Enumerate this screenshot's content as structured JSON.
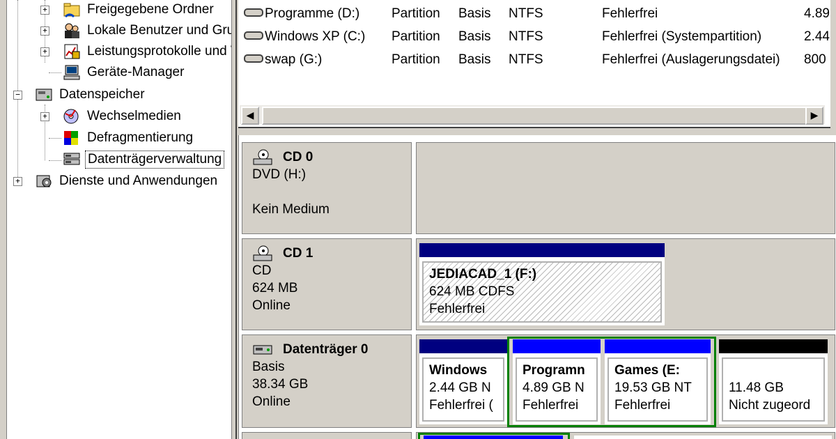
{
  "tree": {
    "items": [
      {
        "label": "Freigegebene Ordner",
        "expander": "+",
        "icon": "shared-folder-icon"
      },
      {
        "label": "Lokale Benutzer und Gruppen",
        "expander": "+",
        "icon": "users-icon"
      },
      {
        "label": "Leistungsprotokolle und Warnungen",
        "expander": "+",
        "icon": "performance-log-icon"
      },
      {
        "label": "Geräte-Manager",
        "expander": "",
        "icon": "device-manager-icon"
      },
      {
        "label": "Datenspeicher",
        "expander": "−",
        "icon": "storage-icon"
      },
      {
        "label": "Wechselmedien",
        "expander": "+",
        "icon": "removable-media-icon"
      },
      {
        "label": "Defragmentierung",
        "expander": "",
        "icon": "defrag-icon"
      },
      {
        "label": "Datenträgerverwaltung",
        "expander": "",
        "icon": "disk-management-icon",
        "selected": true
      },
      {
        "label": "Dienste und Anwendungen",
        "expander": "+",
        "icon": "services-icon"
      }
    ]
  },
  "volume_list": {
    "rows": [
      {
        "name": "Programme (D:)",
        "layout": "Partition",
        "type": "Basis",
        "fs": "NTFS",
        "status": "Fehlerfrei",
        "capacity": "4.89"
      },
      {
        "name": "Windows XP (C:)",
        "layout": "Partition",
        "type": "Basis",
        "fs": "NTFS",
        "status": "Fehlerfrei (Systempartition)",
        "capacity": "2.44"
      },
      {
        "name": "swap (G:)",
        "layout": "Partition",
        "type": "Basis",
        "fs": "NTFS",
        "status": "Fehlerfrei (Auslagerungsdatei)",
        "capacity": "800"
      }
    ],
    "scroll_left": "◀",
    "scroll_right": "▶"
  },
  "disks": {
    "cd0": {
      "name": "CD 0",
      "type": "DVD (H:)",
      "status": "Kein Medium",
      "icon": "cd-drive-icon"
    },
    "cd1": {
      "name": "CD 1",
      "type": "CD",
      "size": "624 MB",
      "status": "Online",
      "icon": "cd-drive-icon",
      "partition": {
        "name": "JEDIACAD_1  (F:)",
        "info": "624 MB CDFS",
        "status": "Fehlerfrei"
      }
    },
    "disk0": {
      "name": "Datenträger 0",
      "type": "Basis",
      "size": "38.34 GB",
      "status": "Online",
      "icon": "hard-disk-icon",
      "partitions": [
        {
          "name": "Windows",
          "info": "2.44 GB N",
          "status": "Fehlerfrei (",
          "bar_color": "#000080"
        },
        {
          "name": "Programn",
          "info": "4.89 GB N",
          "status": "Fehlerfrei",
          "bar_color": "#0000ff"
        },
        {
          "name": "Games  (E:",
          "info": "19.53 GB NT",
          "status": "Fehlerfrei",
          "bar_color": "#0000ff"
        },
        {
          "name": "",
          "info": "11.48 GB",
          "status": "Nicht zugeord",
          "bar_color": "#000000"
        }
      ]
    }
  },
  "colors": {
    "primary_bar": "#000080",
    "logical_bar": "#0000ff",
    "unallocated_bar": "#000000",
    "extended_border": "#008000"
  }
}
